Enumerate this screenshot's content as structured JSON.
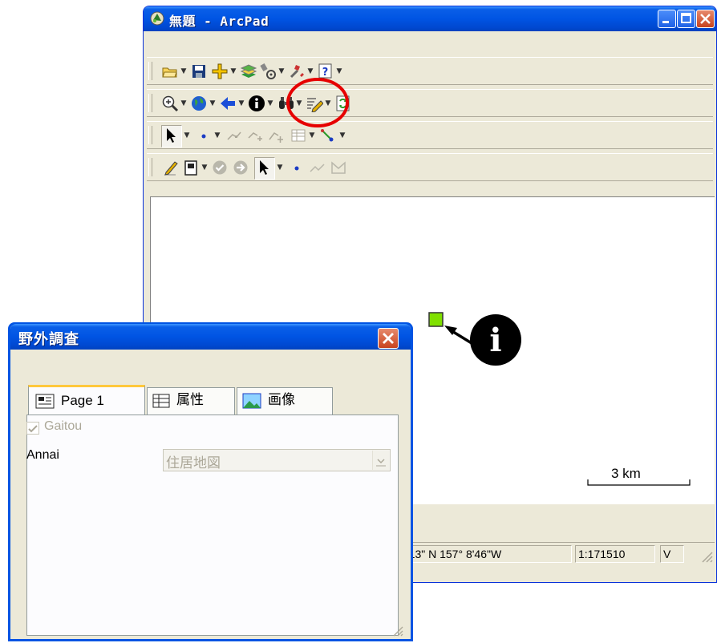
{
  "main_window": {
    "title": "無題 - ArcPad",
    "status": {
      "coords": "'13\" N 157°  8'46\"W",
      "scale": "1:171510",
      "flag": "V"
    },
    "scale_bar": "3 km"
  },
  "dialog": {
    "title": "野外調査",
    "tabs": [
      {
        "label": "Page 1"
      },
      {
        "label": "属性"
      },
      {
        "label": "画像"
      }
    ],
    "checkbox_label": "Gaitou",
    "checkbox_checked": true,
    "field_label": "Annai",
    "field_value": "住居地図"
  },
  "callout_glyph": "i",
  "colors": {
    "titlebar": "#0054e3",
    "highlight_ring": "#e60000",
    "feature_point": "#80e000"
  }
}
